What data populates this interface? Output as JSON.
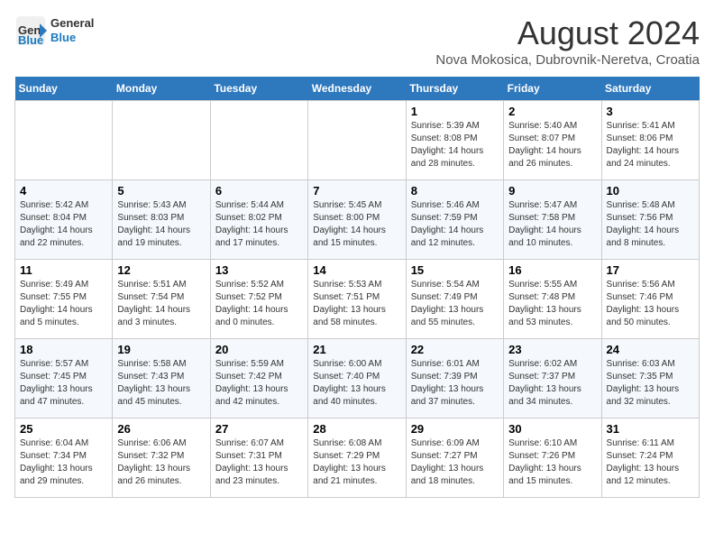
{
  "header": {
    "logo_line1": "General",
    "logo_line2": "Blue",
    "month_year": "August 2024",
    "location": "Nova Mokosica, Dubrovnik-Neretva, Croatia"
  },
  "days_of_week": [
    "Sunday",
    "Monday",
    "Tuesday",
    "Wednesday",
    "Thursday",
    "Friday",
    "Saturday"
  ],
  "weeks": [
    [
      {
        "day": "",
        "info": ""
      },
      {
        "day": "",
        "info": ""
      },
      {
        "day": "",
        "info": ""
      },
      {
        "day": "",
        "info": ""
      },
      {
        "day": "1",
        "info": "Sunrise: 5:39 AM\nSunset: 8:08 PM\nDaylight: 14 hours\nand 28 minutes."
      },
      {
        "day": "2",
        "info": "Sunrise: 5:40 AM\nSunset: 8:07 PM\nDaylight: 14 hours\nand 26 minutes."
      },
      {
        "day": "3",
        "info": "Sunrise: 5:41 AM\nSunset: 8:06 PM\nDaylight: 14 hours\nand 24 minutes."
      }
    ],
    [
      {
        "day": "4",
        "info": "Sunrise: 5:42 AM\nSunset: 8:04 PM\nDaylight: 14 hours\nand 22 minutes."
      },
      {
        "day": "5",
        "info": "Sunrise: 5:43 AM\nSunset: 8:03 PM\nDaylight: 14 hours\nand 19 minutes."
      },
      {
        "day": "6",
        "info": "Sunrise: 5:44 AM\nSunset: 8:02 PM\nDaylight: 14 hours\nand 17 minutes."
      },
      {
        "day": "7",
        "info": "Sunrise: 5:45 AM\nSunset: 8:00 PM\nDaylight: 14 hours\nand 15 minutes."
      },
      {
        "day": "8",
        "info": "Sunrise: 5:46 AM\nSunset: 7:59 PM\nDaylight: 14 hours\nand 12 minutes."
      },
      {
        "day": "9",
        "info": "Sunrise: 5:47 AM\nSunset: 7:58 PM\nDaylight: 14 hours\nand 10 minutes."
      },
      {
        "day": "10",
        "info": "Sunrise: 5:48 AM\nSunset: 7:56 PM\nDaylight: 14 hours\nand 8 minutes."
      }
    ],
    [
      {
        "day": "11",
        "info": "Sunrise: 5:49 AM\nSunset: 7:55 PM\nDaylight: 14 hours\nand 5 minutes."
      },
      {
        "day": "12",
        "info": "Sunrise: 5:51 AM\nSunset: 7:54 PM\nDaylight: 14 hours\nand 3 minutes."
      },
      {
        "day": "13",
        "info": "Sunrise: 5:52 AM\nSunset: 7:52 PM\nDaylight: 14 hours\nand 0 minutes."
      },
      {
        "day": "14",
        "info": "Sunrise: 5:53 AM\nSunset: 7:51 PM\nDaylight: 13 hours\nand 58 minutes."
      },
      {
        "day": "15",
        "info": "Sunrise: 5:54 AM\nSunset: 7:49 PM\nDaylight: 13 hours\nand 55 minutes."
      },
      {
        "day": "16",
        "info": "Sunrise: 5:55 AM\nSunset: 7:48 PM\nDaylight: 13 hours\nand 53 minutes."
      },
      {
        "day": "17",
        "info": "Sunrise: 5:56 AM\nSunset: 7:46 PM\nDaylight: 13 hours\nand 50 minutes."
      }
    ],
    [
      {
        "day": "18",
        "info": "Sunrise: 5:57 AM\nSunset: 7:45 PM\nDaylight: 13 hours\nand 47 minutes."
      },
      {
        "day": "19",
        "info": "Sunrise: 5:58 AM\nSunset: 7:43 PM\nDaylight: 13 hours\nand 45 minutes."
      },
      {
        "day": "20",
        "info": "Sunrise: 5:59 AM\nSunset: 7:42 PM\nDaylight: 13 hours\nand 42 minutes."
      },
      {
        "day": "21",
        "info": "Sunrise: 6:00 AM\nSunset: 7:40 PM\nDaylight: 13 hours\nand 40 minutes."
      },
      {
        "day": "22",
        "info": "Sunrise: 6:01 AM\nSunset: 7:39 PM\nDaylight: 13 hours\nand 37 minutes."
      },
      {
        "day": "23",
        "info": "Sunrise: 6:02 AM\nSunset: 7:37 PM\nDaylight: 13 hours\nand 34 minutes."
      },
      {
        "day": "24",
        "info": "Sunrise: 6:03 AM\nSunset: 7:35 PM\nDaylight: 13 hours\nand 32 minutes."
      }
    ],
    [
      {
        "day": "25",
        "info": "Sunrise: 6:04 AM\nSunset: 7:34 PM\nDaylight: 13 hours\nand 29 minutes."
      },
      {
        "day": "26",
        "info": "Sunrise: 6:06 AM\nSunset: 7:32 PM\nDaylight: 13 hours\nand 26 minutes."
      },
      {
        "day": "27",
        "info": "Sunrise: 6:07 AM\nSunset: 7:31 PM\nDaylight: 13 hours\nand 23 minutes."
      },
      {
        "day": "28",
        "info": "Sunrise: 6:08 AM\nSunset: 7:29 PM\nDaylight: 13 hours\nand 21 minutes."
      },
      {
        "day": "29",
        "info": "Sunrise: 6:09 AM\nSunset: 7:27 PM\nDaylight: 13 hours\nand 18 minutes."
      },
      {
        "day": "30",
        "info": "Sunrise: 6:10 AM\nSunset: 7:26 PM\nDaylight: 13 hours\nand 15 minutes."
      },
      {
        "day": "31",
        "info": "Sunrise: 6:11 AM\nSunset: 7:24 PM\nDaylight: 13 hours\nand 12 minutes."
      }
    ]
  ]
}
